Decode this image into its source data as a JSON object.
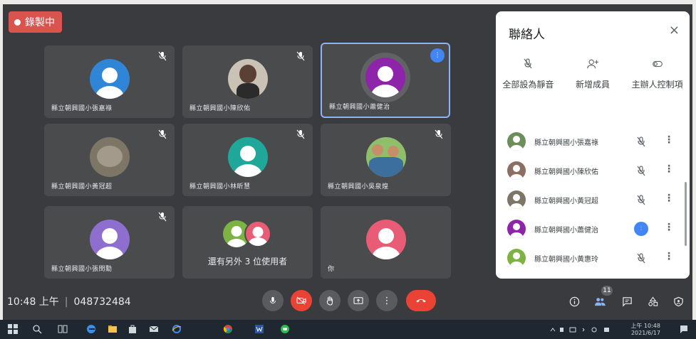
{
  "recording": {
    "label": "錄製中"
  },
  "tiles": [
    {
      "name": "縣立朝興國小張嘉祿",
      "avatar_color": "#2f86d6",
      "type": "avatar",
      "muted": true
    },
    {
      "name": "縣立朝興國小陳欣佑",
      "avatar_color": "#c9c2b5",
      "type": "photo",
      "muted": true
    },
    {
      "name": "縣立朝興國小蕭健治",
      "avatar_color": "#8e24aa",
      "type": "speaking",
      "muted": false
    },
    {
      "name": "縣立朝興國小黃冠超",
      "avatar_color": "#7d7566",
      "type": "photo",
      "muted": true
    },
    {
      "name": "縣立朝興國小林昕慧",
      "avatar_color": "#1fa89a",
      "type": "avatar",
      "muted": true
    },
    {
      "name": "縣立朝興國小吳泉煌",
      "avatar_color": "#8fbf6a",
      "type": "photo",
      "muted": true
    },
    {
      "name": "縣立朝興國小張閔勳",
      "avatar_color": "#8e6fcf",
      "type": "avatar",
      "muted": true
    },
    {
      "name": "",
      "avatar_color": "#7cb342",
      "type": "others",
      "muted": false
    },
    {
      "name": "你",
      "avatar_color": "#e85d75",
      "type": "avatar",
      "muted": false
    }
  ],
  "others": {
    "text": "還有另外 3 位使用者"
  },
  "panel": {
    "title": "聯絡人",
    "close": "×",
    "actions": [
      {
        "icon": "mute-all-icon",
        "glyph": "🎙",
        "label": "全部設為靜音"
      },
      {
        "icon": "add-person-icon",
        "glyph": "➕",
        "label": "新增成員"
      },
      {
        "icon": "host-controls-icon",
        "glyph": "⊙",
        "label": "主辦人控制項"
      }
    ],
    "people": [
      {
        "name": "縣立朝興國小張嘉祿",
        "avatar_color": "#6b8e5a",
        "speaking": false
      },
      {
        "name": "縣立朝興國小陳欣佑",
        "avatar_color": "#8d6e63",
        "speaking": false
      },
      {
        "name": "縣立朝興國小黃冠超",
        "avatar_color": "#7d7566",
        "speaking": false
      },
      {
        "name": "縣立朝興國小蕭健治",
        "avatar_color": "#8e24aa",
        "speaking": true
      },
      {
        "name": "縣立朝興國小黃惠玲",
        "avatar_color": "#7cb342",
        "speaking": false
      }
    ],
    "more": "⋮"
  },
  "bar": {
    "time": "10:48 上午",
    "separator": "|",
    "meeting_code": "048732484",
    "participants_count": "11"
  },
  "taskbar": {
    "time": "上午 10:48",
    "date": "2021/6/17"
  }
}
